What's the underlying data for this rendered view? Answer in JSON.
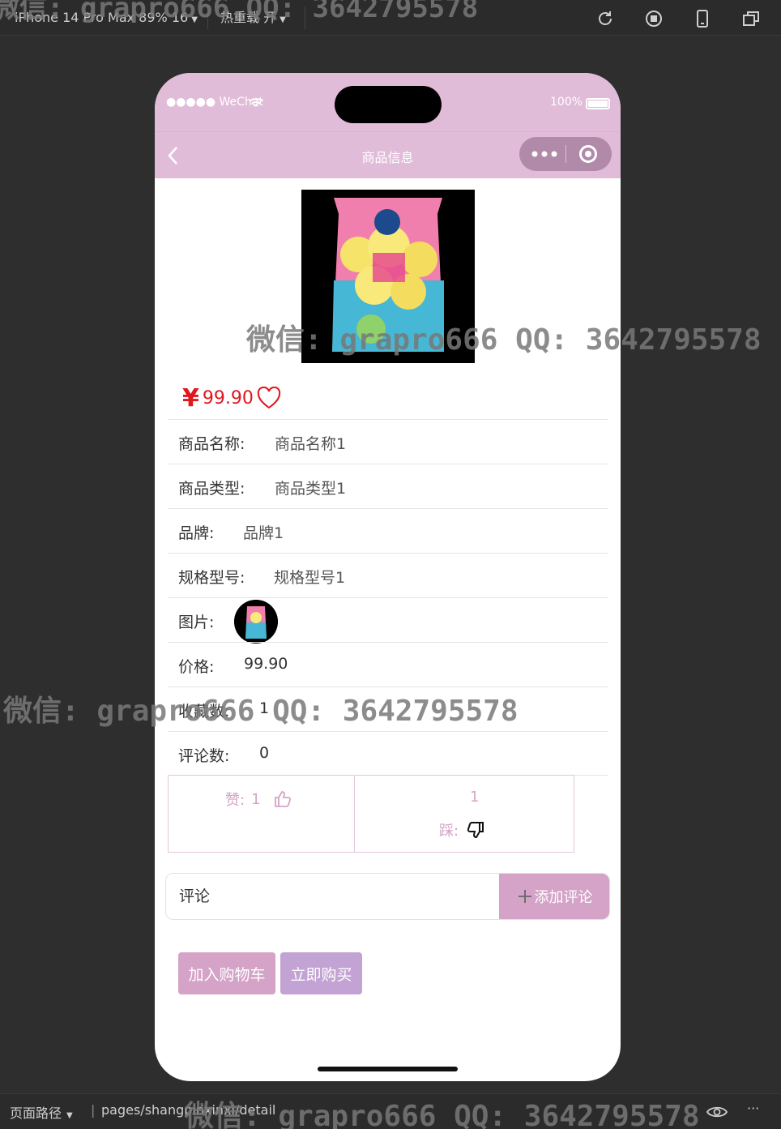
{
  "toolbar": {
    "device": "iPhone 14 Pro Max 89% 16",
    "hot_reload": "热重载 开"
  },
  "statusbar": {
    "carrier": "●●●●● WeChat",
    "battery": "100%"
  },
  "navbar": {
    "title": "商品信息"
  },
  "product": {
    "price_symbol": "¥",
    "price": "99.90",
    "fields": [
      {
        "label": "商品名称:",
        "value": "商品名称1"
      },
      {
        "label": "商品类型:",
        "value": "商品类型1"
      },
      {
        "label": "品牌:",
        "value": "品牌1"
      },
      {
        "label": "规格型号:",
        "value": "规格型号1"
      },
      {
        "label": "图片:",
        "value": ""
      },
      {
        "label": "价格:",
        "value": "99.90"
      },
      {
        "label": "收藏数:",
        "value": "1"
      },
      {
        "label": "评论数:",
        "value": "0"
      }
    ]
  },
  "votes": {
    "like_label": "赞:",
    "like_count": "1",
    "dislike_count": "1",
    "dislike_label": "踩:"
  },
  "comment": {
    "placeholder": "评论",
    "add_button": "添加评论"
  },
  "actions": {
    "add_to_cart": "加入购物车",
    "buy_now": "立即购买"
  },
  "bottombar": {
    "page_path_label": "页面路径",
    "page_path": "pages/shangpinxinxi/detail"
  },
  "watermark": "微信: grapro666 QQ: 3642795578",
  "colors": {
    "accent_pink": "#d4a3c7",
    "navbar": "#e1bcd9",
    "price_red": "#e0171f",
    "buy_purple": "#c3a2d4"
  }
}
